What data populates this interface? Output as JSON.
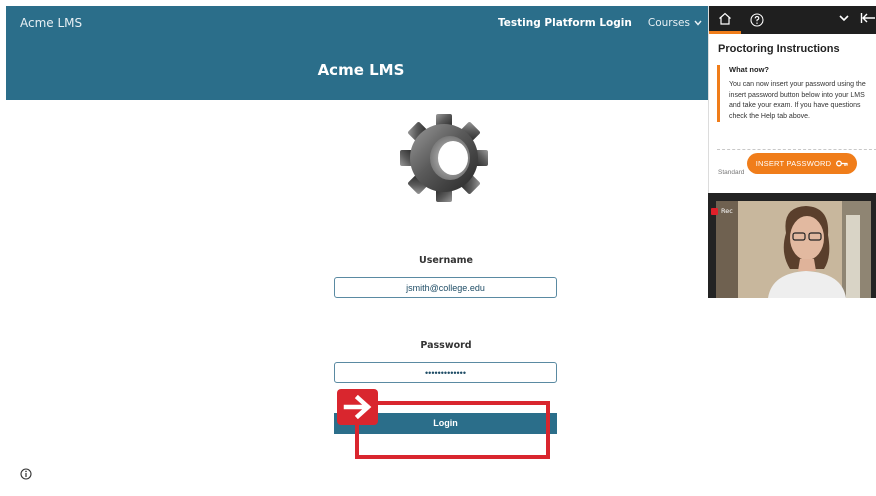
{
  "app": {
    "brand": "Acme LMS",
    "nav_login": "Testing Platform Login",
    "nav_courses": "Courses",
    "hero_title": "Acme LMS"
  },
  "form": {
    "username_label": "Username",
    "username_value": "jsmith@college.edu",
    "password_label": "Password",
    "password_value": "•••••••••••••",
    "login_label": "Login"
  },
  "proctor": {
    "heading": "Proctoring Instructions",
    "note_title": "What now?",
    "note_body": "You can now insert your password using the insert password button below into your LMS and take your exam. If you have questions check the Help tab above.",
    "standard_label": "Standard",
    "insert_password_label": "INSERT PASSWORD",
    "rec_label": "Rec"
  },
  "colors": {
    "header_bg": "#2b6e8a",
    "accent_orange": "#f07d1a",
    "annotation_red": "#d9262e"
  },
  "icons": [
    "home-icon",
    "help-icon",
    "chevron-down-icon",
    "collapse-left-icon",
    "key-icon",
    "info-icon",
    "gear-logo",
    "arrow-right-icon"
  ]
}
